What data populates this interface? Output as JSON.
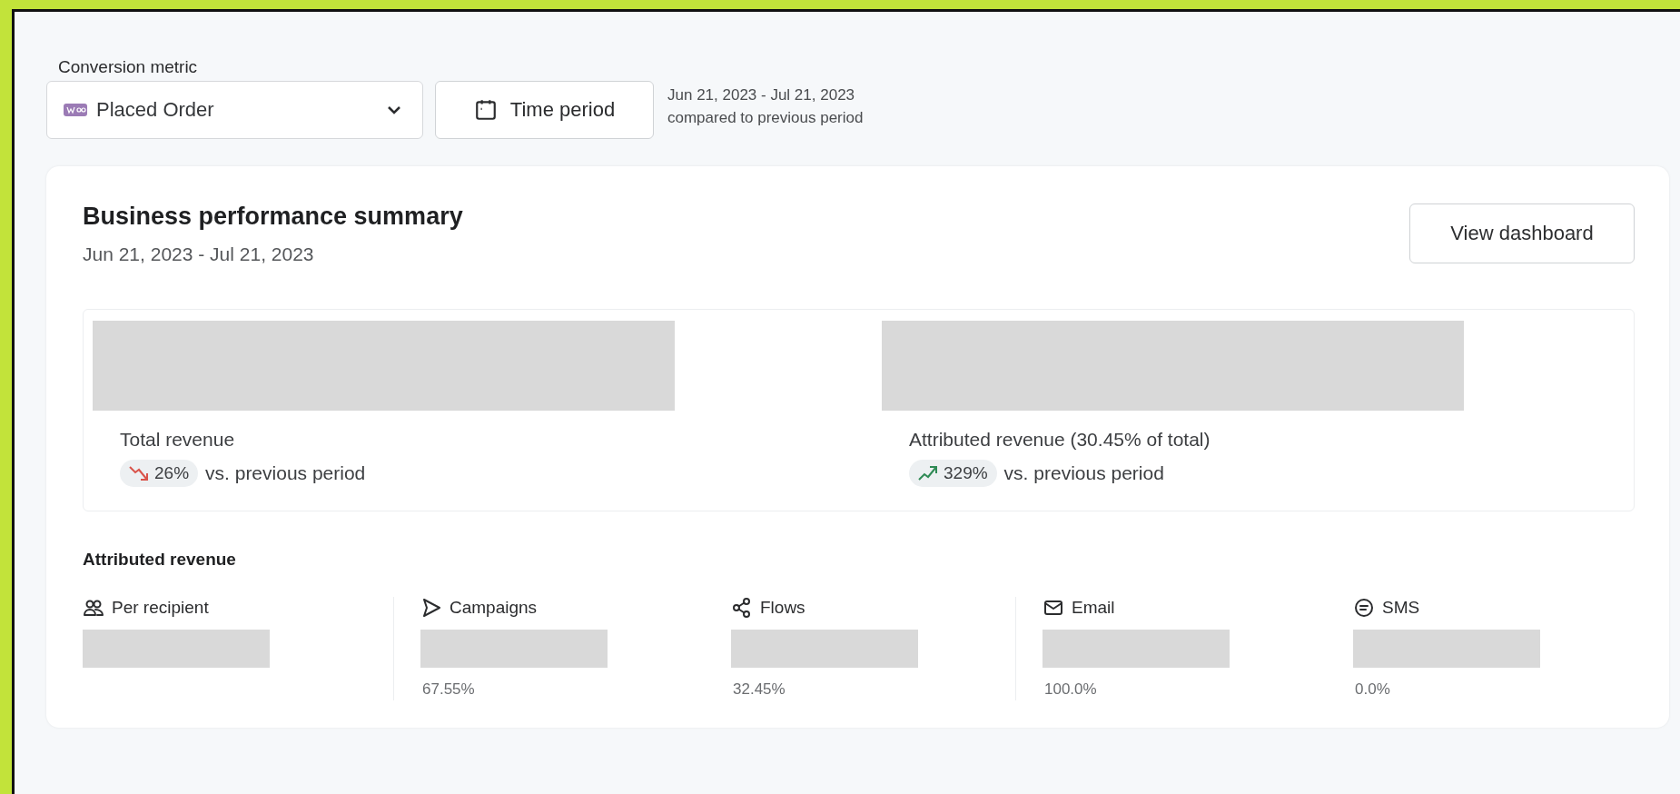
{
  "metric_selector": {
    "label": "Conversion metric",
    "value": "Placed Order"
  },
  "time_period": {
    "label": "Time period",
    "range": "Jun 21, 2023 - Jul 21, 2023",
    "comparison": "compared to previous period"
  },
  "summary": {
    "title": "Business performance summary",
    "date_range": "Jun 21, 2023 - Jul 21, 2023",
    "button": "View dashboard",
    "metrics": [
      {
        "label": "Total revenue",
        "change": "26%",
        "kind": "down",
        "suffix": "vs. previous period"
      },
      {
        "label": "Attributed revenue (30.45% of total)",
        "change": "329%",
        "kind": "up",
        "suffix": "vs. previous period"
      }
    ]
  },
  "attributed": {
    "title": "Attributed revenue",
    "groups": [
      [
        {
          "label": "Per recipient",
          "kind": "people"
        }
      ],
      [
        {
          "label": "Campaigns",
          "kind": "send",
          "share": "67.55%"
        },
        {
          "label": "Flows",
          "kind": "flow",
          "share": "32.45%"
        }
      ],
      [
        {
          "label": "Email",
          "kind": "mail",
          "share": "100.0%"
        },
        {
          "label": "SMS",
          "kind": "chat",
          "share": "0.0%"
        }
      ]
    ]
  }
}
